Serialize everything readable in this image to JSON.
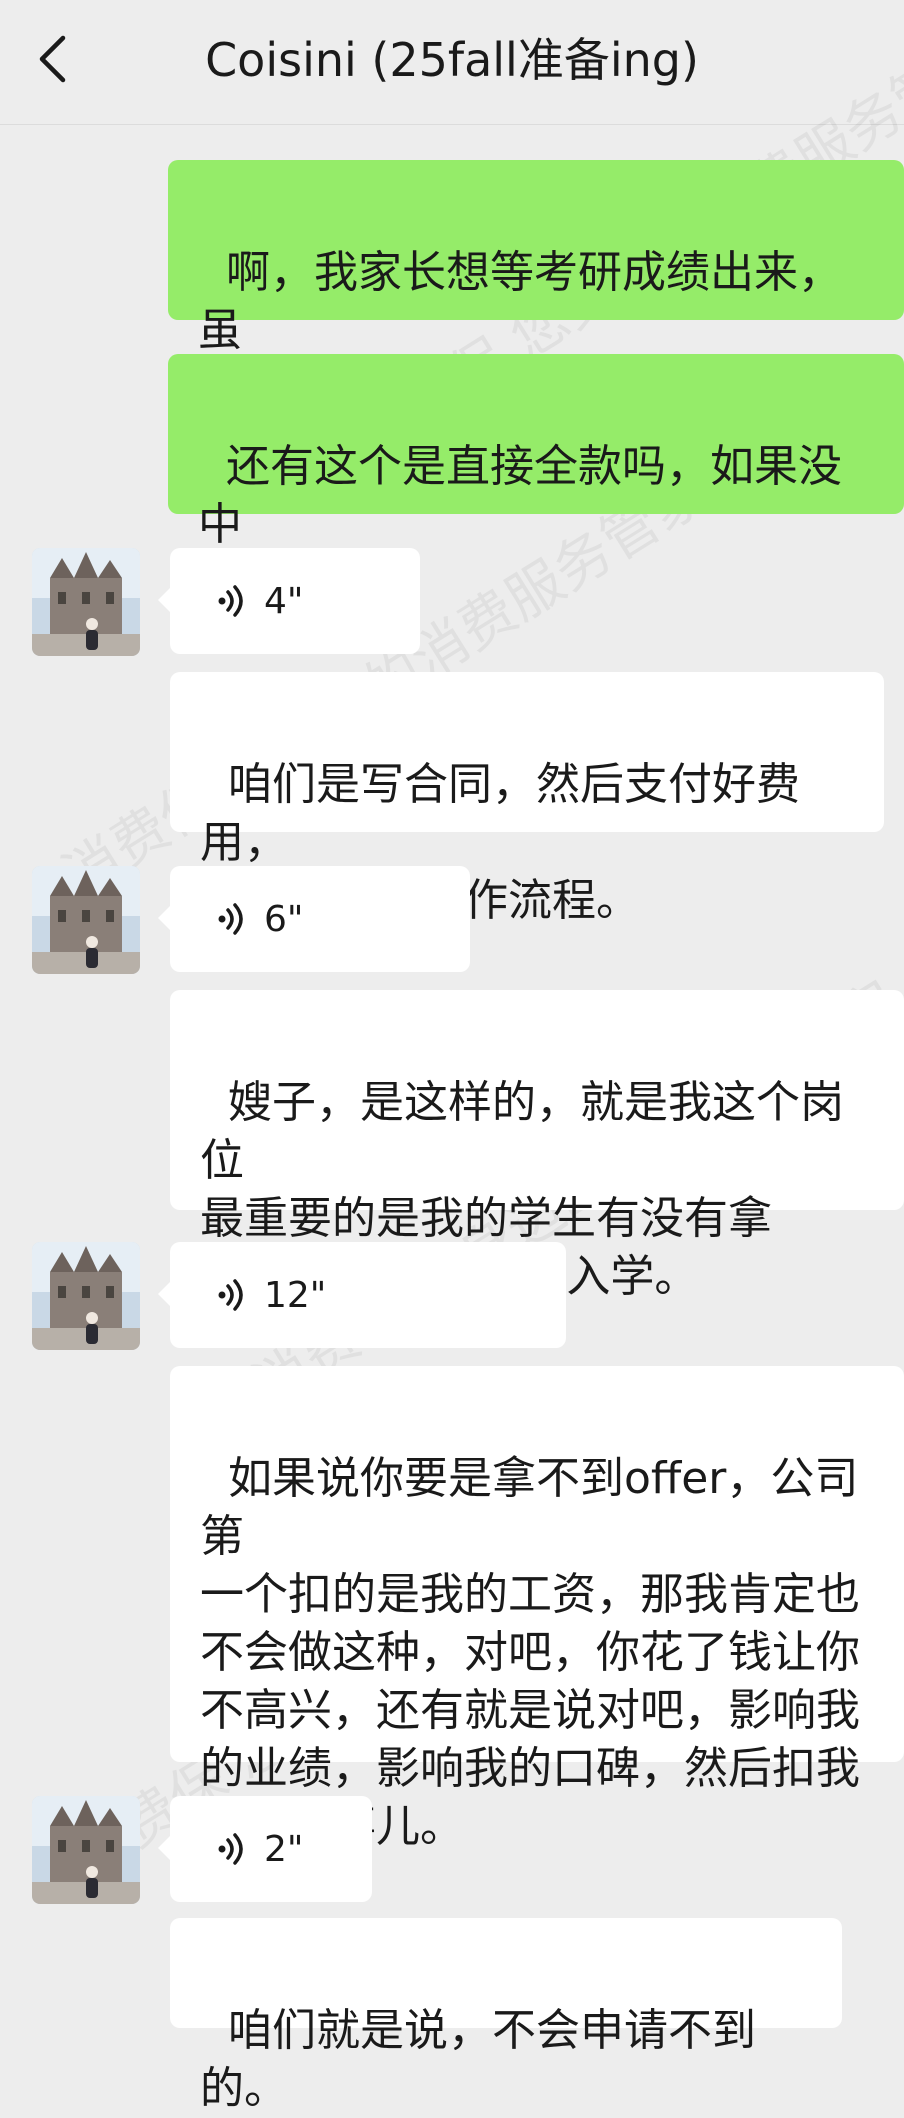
{
  "header": {
    "title": "Coisini (25fall准备ing)"
  },
  "watermark": {
    "text": "消费保 您身边的消费服务管家"
  },
  "messages": [
    {
      "type": "text",
      "side": "self",
      "text": "啊，我家长想等考研成绩出来，虽\n然我自己是觉得确实没什么希望"
    },
    {
      "type": "text",
      "side": "self",
      "text": "还有这个是直接全款吗，如果没中\n会怎么样呢"
    },
    {
      "type": "voice",
      "side": "other",
      "duration": "4\""
    },
    {
      "type": "text",
      "side": "other",
      "text": "咱们是写合同，然后支付好费用，\n赶紧去帮你操作流程。"
    },
    {
      "type": "voice",
      "side": "other",
      "duration": "6\""
    },
    {
      "type": "text",
      "side": "other",
      "text": "嫂子，是这样的，就是我这个岗位\n最重要的是我的学生有没有拿\noffer，还有你没有入学。"
    },
    {
      "type": "voice",
      "side": "other",
      "duration": "12\""
    },
    {
      "type": "text",
      "side": "other",
      "text": "如果说你要是拿不到offer，公司第\n一个扣的是我的工资，那我肯定也\n不会做这种，对吧，你花了钱让你\n不高兴，还有就是说对吧，影响我\n的业绩，影响我的口碑，然后扣我\n工资的事儿。"
    },
    {
      "type": "voice",
      "side": "other",
      "duration": "2\""
    },
    {
      "type": "text",
      "side": "other",
      "text": "咱们就是说，不会申请不到的。"
    }
  ],
  "colors": {
    "self_bubble": "#95ec69",
    "other_bubble": "#ffffff",
    "background": "#ededed"
  }
}
